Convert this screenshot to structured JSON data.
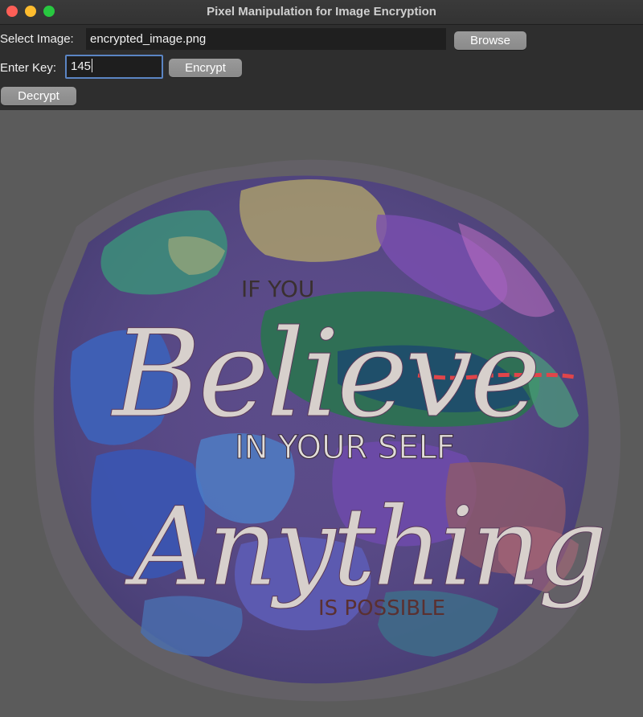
{
  "window": {
    "title": "Pixel Manipulation for Image Encryption"
  },
  "controls": {
    "select_label": "Select Image:",
    "file_path": "encrypted_image.png",
    "browse_label": "Browse",
    "key_label": "Enter Key:",
    "key_value": "145",
    "encrypt_label": "Encrypt",
    "decrypt_label": "Decrypt"
  },
  "image": {
    "top_small": "IF YOU",
    "big_word_1": "Believe",
    "middle": "IN YOUR SELF",
    "big_word_2": "Anything",
    "bottom_small": "IS POSSIBLE"
  }
}
